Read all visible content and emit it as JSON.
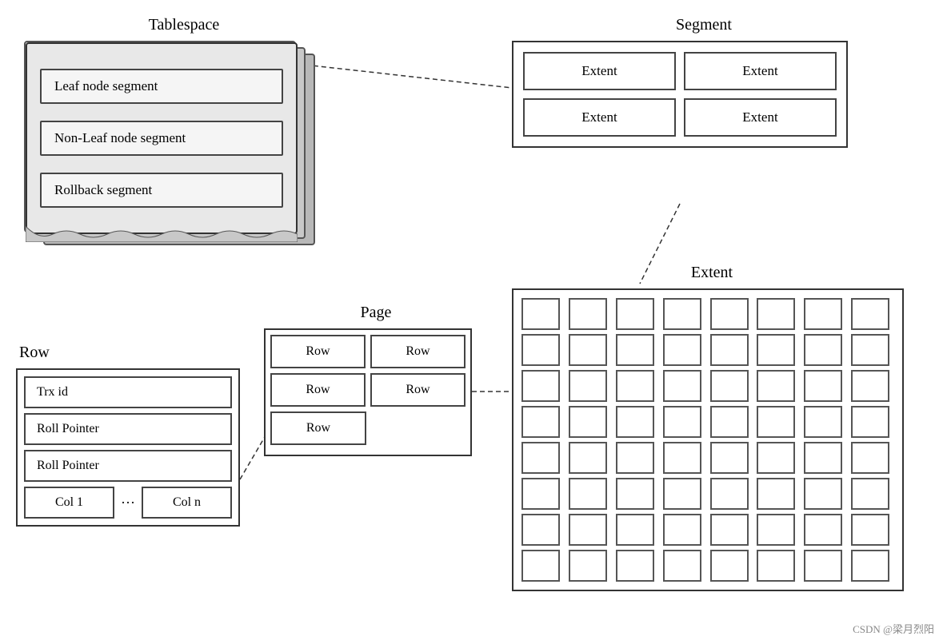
{
  "tablespace": {
    "label": "Tablespace",
    "segments": [
      {
        "text": "Leaf node segment"
      },
      {
        "text": "Non-Leaf node segment"
      },
      {
        "text": "Rollback segment"
      }
    ]
  },
  "segment": {
    "label": "Segment",
    "extents": [
      "Extent",
      "Extent",
      "Extent",
      "Extent"
    ]
  },
  "extent": {
    "label": "Extent",
    "grid_rows": 8,
    "grid_cols": 8
  },
  "page": {
    "label": "Page",
    "rows": [
      [
        "Row",
        "Row"
      ],
      [
        "Row",
        "Row"
      ],
      [
        "Row"
      ]
    ]
  },
  "row": {
    "label": "Row",
    "fields": [
      "Trx id",
      "Roll Pointer",
      "Roll Pointer"
    ],
    "cols": [
      "Col 1",
      "Col n"
    ],
    "dots": "···"
  },
  "watermark": "CSDN @梁月烈阳"
}
